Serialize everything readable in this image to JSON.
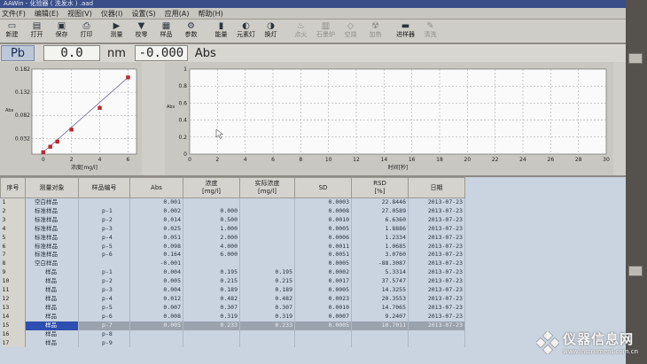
{
  "window": {
    "title": "AAWin - 化验器 ( 洗发水 ) .aad"
  },
  "menu": [
    "文件(F)",
    "编辑(E)",
    "视图(V)",
    "仪器(I)",
    "设置(S)",
    "应用(A)",
    "帮助(H)"
  ],
  "toolbar": [
    {
      "label": "新建",
      "icon": "new-file-icon",
      "glyph": "▭",
      "enabled": true
    },
    {
      "label": "打开",
      "icon": "open-folder-icon",
      "glyph": "▤",
      "enabled": true
    },
    {
      "label": "保存",
      "icon": "save-icon",
      "glyph": "▣",
      "enabled": true
    },
    {
      "label": "打印",
      "icon": "print-icon",
      "glyph": "⎙",
      "enabled": true
    },
    {
      "label": "测量",
      "icon": "measure-icon",
      "glyph": "▶",
      "enabled": true
    },
    {
      "label": "校零",
      "icon": "zero-icon",
      "glyph": "▼",
      "enabled": true
    },
    {
      "label": "样品",
      "icon": "sample-icon",
      "glyph": "▦",
      "enabled": true
    },
    {
      "label": "参数",
      "icon": "parameters-icon",
      "glyph": "⚙",
      "enabled": true
    },
    {
      "label": "能量",
      "icon": "energy-icon",
      "glyph": "▮",
      "enabled": true
    },
    {
      "label": "元素灯",
      "icon": "element-lamp-icon",
      "glyph": "◐",
      "enabled": true
    },
    {
      "label": "换灯",
      "icon": "change-lamp-icon",
      "glyph": "◑",
      "enabled": true
    },
    {
      "label": "点火",
      "icon": "ignite-icon",
      "glyph": "♨",
      "enabled": false
    },
    {
      "label": "石墨炉",
      "icon": "graphite-furnace-icon",
      "glyph": "▥",
      "enabled": false
    },
    {
      "label": "空烧",
      "icon": "dry-burn-icon",
      "glyph": "◇",
      "enabled": false
    },
    {
      "label": "加热",
      "icon": "heat-icon",
      "glyph": "☢",
      "enabled": false
    },
    {
      "label": "进样器",
      "icon": "autosampler-icon",
      "glyph": "▬",
      "enabled": true
    },
    {
      "label": "清洗",
      "icon": "clean-icon",
      "glyph": "✎",
      "enabled": false
    }
  ],
  "readout": {
    "element": "Pb",
    "wavelength": "0.0",
    "wavelength_unit": "nm",
    "absorbance": "-0.000",
    "absorbance_unit": "Abs"
  },
  "chart_data": [
    {
      "type": "scatter",
      "title": "",
      "xlabel": "浓度[mg/l]",
      "ylabel": "Abs",
      "xlim": [
        -0.8,
        6.6
      ],
      "ylim": [
        -0.002,
        0.182
      ],
      "yticks": [
        "0.182",
        "0.132",
        "0.082",
        "0.032"
      ],
      "xticks": [
        "0",
        "2",
        "4",
        "6"
      ],
      "points": [
        {
          "x": 0.0,
          "y": 0.002
        },
        {
          "x": 0.5,
          "y": 0.014
        },
        {
          "x": 1.0,
          "y": 0.025
        },
        {
          "x": 2.0,
          "y": 0.051
        },
        {
          "x": 4.0,
          "y": 0.098
        },
        {
          "x": 6.0,
          "y": 0.164
        }
      ],
      "fit_line": [
        {
          "x": 0.0,
          "y": 0.002
        },
        {
          "x": 6.0,
          "y": 0.164
        }
      ],
      "grid": true
    },
    {
      "type": "line",
      "title": "",
      "xlabel": "时间[秒]",
      "ylabel": "Abs",
      "xlim": [
        0,
        30
      ],
      "ylim": [
        0,
        1
      ],
      "xticks": [
        "0",
        "2",
        "4",
        "6",
        "8",
        "10",
        "12",
        "14",
        "16",
        "18",
        "20",
        "22",
        "24",
        "26",
        "28",
        "30"
      ],
      "yticks": [
        "1",
        "0.8",
        "0.6",
        "0.4",
        "0.2",
        "0"
      ],
      "series": [],
      "grid": true
    }
  ],
  "table": {
    "headers": [
      "序号",
      "测量对象",
      "样品编号",
      "Abs",
      "浓度\n[mg/l]",
      "实际浓度\n[mg/l]",
      "SD",
      "RSD\n[%]",
      "日期"
    ],
    "rows": [
      [
        "1",
        "空白样品",
        "",
        "0.001",
        "",
        "",
        "0.0003",
        "22.8446",
        "2013-07-23"
      ],
      [
        "2",
        "标准样品",
        "p-1",
        "0.002",
        "0.000",
        "",
        "0.0008",
        "27.0589",
        "2013-07-23"
      ],
      [
        "3",
        "标准样品",
        "p-2",
        "0.014",
        "0.500",
        "",
        "0.0010",
        "6.6360",
        "2013-07-23"
      ],
      [
        "4",
        "标准样品",
        "p-3",
        "0.025",
        "1.000",
        "",
        "0.0005",
        "1.8886",
        "2013-07-23"
      ],
      [
        "5",
        "标准样品",
        "p-4",
        "0.051",
        "2.000",
        "",
        "0.0006",
        "1.2334",
        "2013-07-23"
      ],
      [
        "6",
        "标准样品",
        "p-5",
        "0.098",
        "4.000",
        "",
        "0.0011",
        "1.0685",
        "2013-07-23"
      ],
      [
        "7",
        "标准样品",
        "p-6",
        "0.164",
        "6.000",
        "",
        "0.0051",
        "3.0760",
        "2013-07-23"
      ],
      [
        "8",
        "空白样品",
        "",
        "-0.001",
        "",
        "",
        "0.0005",
        "-88.3087",
        "2013-07-23"
      ],
      [
        "9",
        "样品",
        "p-1",
        "0.004",
        "0.195",
        "0.195",
        "0.0002",
        "5.3314",
        "2013-07-23"
      ],
      [
        "10",
        "样品",
        "p-2",
        "0.005",
        "0.215",
        "0.215",
        "0.0017",
        "37.5747",
        "2013-07-23"
      ],
      [
        "11",
        "样品",
        "p-3",
        "0.004",
        "0.189",
        "0.189",
        "0.0005",
        "14.3255",
        "2013-07-23"
      ],
      [
        "12",
        "样品",
        "p-4",
        "0.012",
        "0.482",
        "0.482",
        "0.0023",
        "20.3553",
        "2013-07-23"
      ],
      [
        "13",
        "样品",
        "p-5",
        "0.007",
        "0.307",
        "0.307",
        "0.0010",
        "14.7065",
        "2013-07-23"
      ],
      [
        "14",
        "样品",
        "p-6",
        "0.008",
        "0.319",
        "0.319",
        "0.0007",
        "9.2407",
        "2013-07-23"
      ],
      [
        "15",
        "样品",
        "p-7",
        "0.005",
        "0.233",
        "0.233",
        "0.0005",
        "10.7011",
        "2013-07-23"
      ],
      [
        "16",
        "样品",
        "p-8",
        "",
        "",
        "",
        "",
        "",
        ""
      ],
      [
        "17",
        "样品",
        "p-9",
        "",
        "",
        "",
        "",
        "",
        ""
      ]
    ],
    "selected_row": 15
  },
  "watermark": {
    "text": "仪器信息网",
    "url": "www.instrument.com.cn"
  }
}
